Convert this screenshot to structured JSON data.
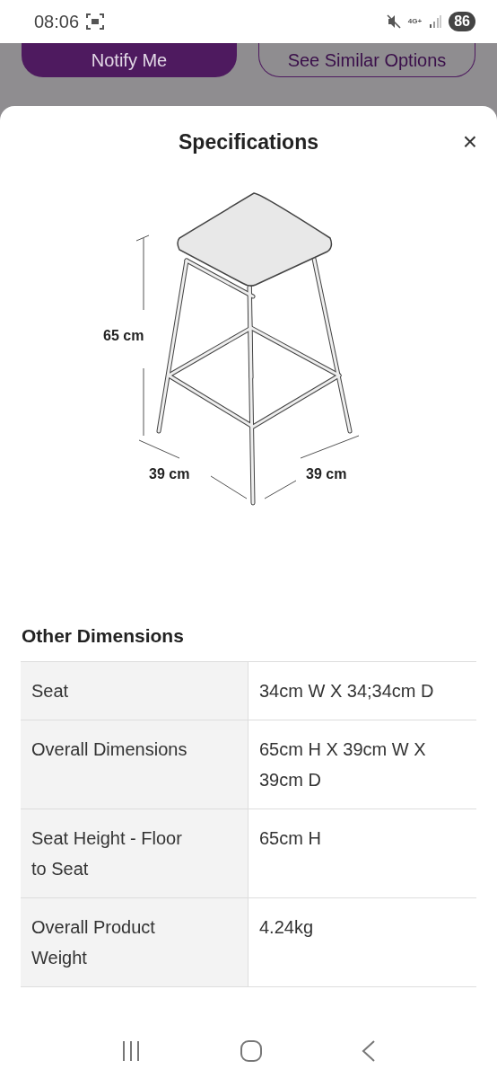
{
  "status_bar": {
    "time": "08:06",
    "network": "4G+",
    "battery": "86"
  },
  "background_buttons": [
    {
      "label": "Notify Me",
      "kind": "primary"
    },
    {
      "label": "See Similar Options",
      "kind": "outline"
    }
  ],
  "sheet": {
    "title": "Specifications",
    "close": "×",
    "diagram_labels": {
      "height": "65 cm",
      "width": "39 cm",
      "depth": "39 cm"
    },
    "section_title": "Other Dimensions",
    "rows": [
      {
        "name": "Seat",
        "value": "34cm W X 34;34cm D"
      },
      {
        "name": "Overall Dimensions",
        "value": "65cm H X 39cm W X 39cm D"
      },
      {
        "name": "Seat Height - Floor to Seat",
        "value": "65cm H"
      },
      {
        "name": "Overall Product Weight",
        "value": "4.24kg"
      }
    ]
  }
}
